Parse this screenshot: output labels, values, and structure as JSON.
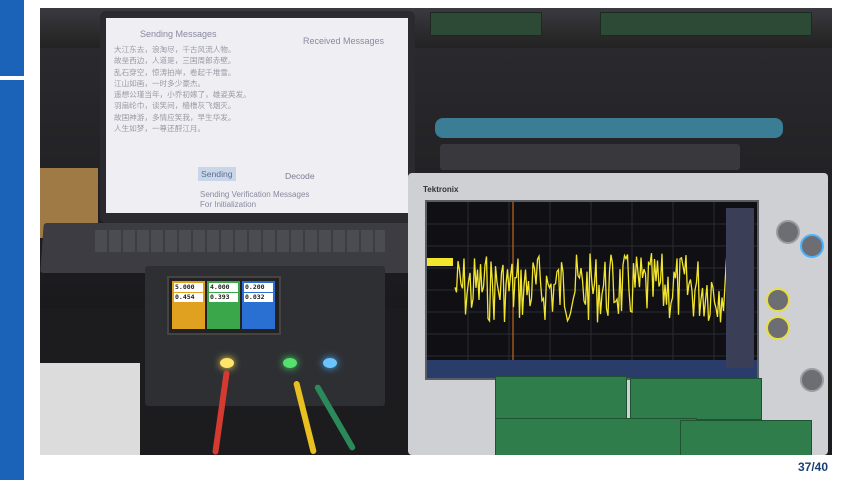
{
  "slide": {
    "page_number": "37/40"
  },
  "laptop_app": {
    "sending_title": "Sending Messages",
    "received_title": "Received Messages",
    "message_lines": [
      "大江东去，浪淘尽，千古风流人物。",
      "故垒西边，人道是，三国周郎赤壁。",
      "乱石穿空，惊涛拍岸，卷起千堆雪。",
      "江山如画，一时多少豪杰。",
      "遥想公瑾当年，小乔初嫁了，雄姿英发。",
      "羽扇纶巾，谈笑间，樯橹灰飞烟灭。",
      "故国神游，多情应笑我，早生华发。",
      "人生如梦，一尊还酹江月。"
    ],
    "sending_button": "Sending",
    "decode_button": "Decode",
    "verification_line1": "Sending Verification Messages",
    "verification_line2": "For Initialization"
  },
  "power_supply": {
    "channels": [
      {
        "voltage": "5.000",
        "current": "0.454"
      },
      {
        "voltage": "4.000",
        "current": "0.393"
      },
      {
        "voltage": "0.200",
        "current": "0.032"
      }
    ]
  },
  "oscilloscope": {
    "brand": "Tektronix"
  },
  "colors": {
    "accent_bar": "#1a63b8",
    "page_number": "#1a3f73",
    "waveform": "#f2e62c"
  }
}
